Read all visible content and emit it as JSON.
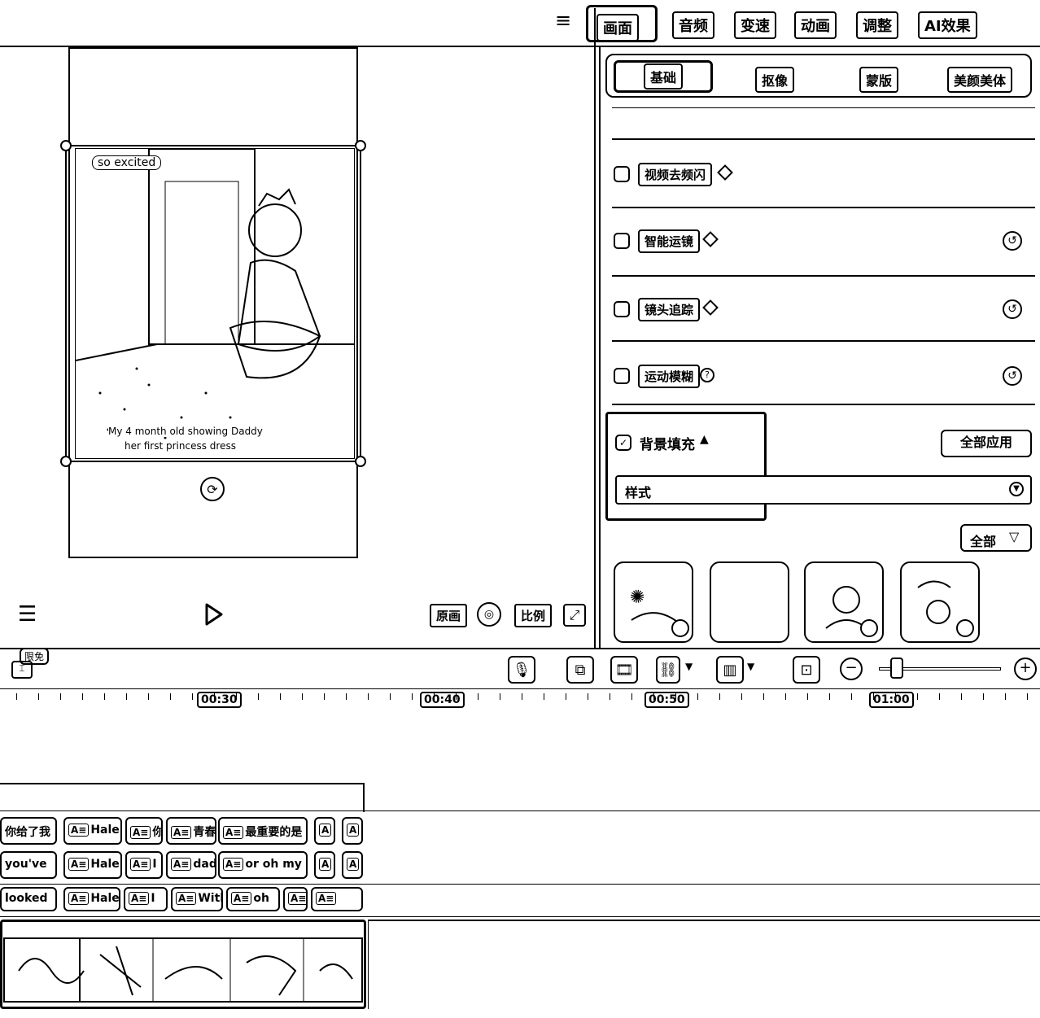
{
  "top_tabs": [
    "画面",
    "音频",
    "变速",
    "动画",
    "调整",
    "AI效果"
  ],
  "sub_tabs": [
    "基础",
    "抠像",
    "蒙版",
    "美颜美体"
  ],
  "options": [
    {
      "label": "视频去频闪"
    },
    {
      "label": "智能运镜"
    },
    {
      "label": "镜头追踪"
    },
    {
      "label": "运动模糊"
    }
  ],
  "bg_fill": {
    "label": "背景填充",
    "apply_all": "全部应用",
    "style_label": "样式",
    "filter_label": "全部"
  },
  "preview": {
    "caption_top": "so excited",
    "caption_bottom_line1": "My 4 month old showing Daddy",
    "caption_bottom_line2": "her first princess dress",
    "controls": [
      "原画",
      "比例"
    ]
  },
  "timeline": {
    "badge": "限免",
    "marks": [
      "00:30",
      "00:40",
      "00:50",
      "01:00"
    ]
  },
  "subtitle_rows": [
    [
      "你给了我",
      "Hale",
      "你",
      "青春",
      "最重要的是"
    ],
    [
      "you've",
      "Hale",
      "I",
      "dad",
      "or oh my"
    ],
    [
      "looked",
      "Hale",
      "I",
      "With",
      "oh"
    ]
  ],
  "colors": {
    "ink": "#000000",
    "bg": "#ffffff"
  }
}
